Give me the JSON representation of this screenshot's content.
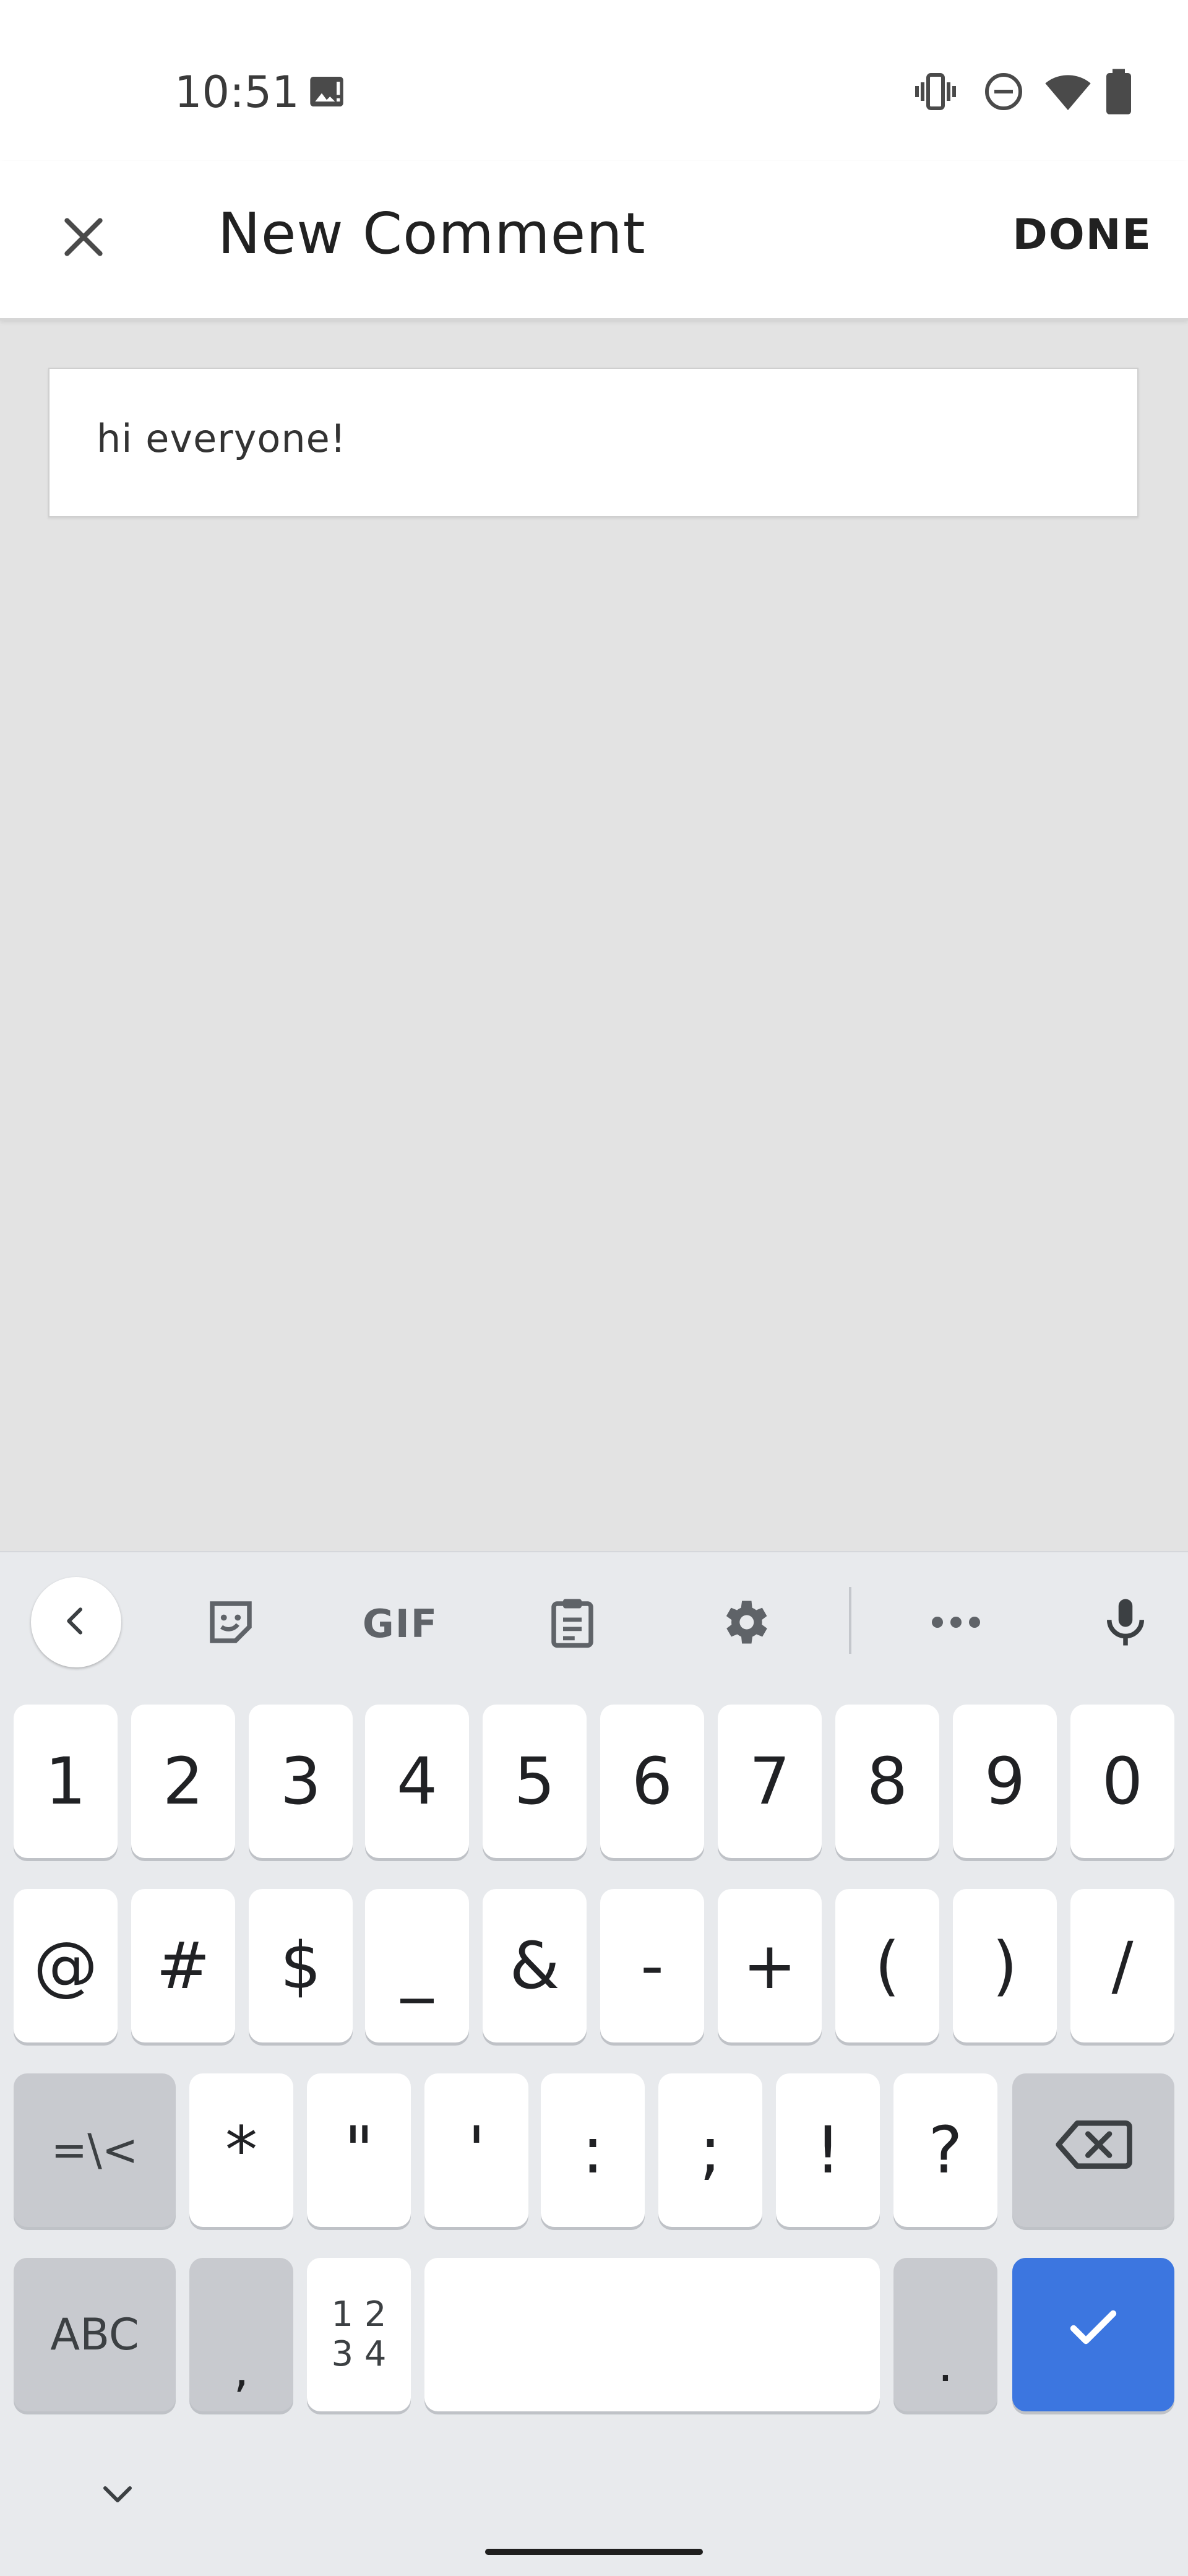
{
  "status_bar": {
    "time": "10:51"
  },
  "app_bar": {
    "title": "New Comment",
    "done_label": "DONE"
  },
  "comment": {
    "value": "hi everyone!"
  },
  "keyboard": {
    "toolbar": {
      "gif_label": "GIF"
    },
    "row1": [
      "1",
      "2",
      "3",
      "4",
      "5",
      "6",
      "7",
      "8",
      "9",
      "0"
    ],
    "row2": [
      "@",
      "#",
      "$",
      "_",
      "&",
      "-",
      "+",
      "(",
      ")",
      "/"
    ],
    "row3": [
      "=\\<",
      "*",
      "\"",
      "'",
      ":",
      ";",
      "!",
      "?"
    ],
    "row4": {
      "abc": "ABC",
      "comma": ",",
      "numpad_top": "1 2",
      "numpad_bottom": "3 4",
      "period": "."
    }
  },
  "colors": {
    "accent": "#3c76e0",
    "background": "#e3e3e3",
    "keyboard_bg": "#e8eaed"
  }
}
